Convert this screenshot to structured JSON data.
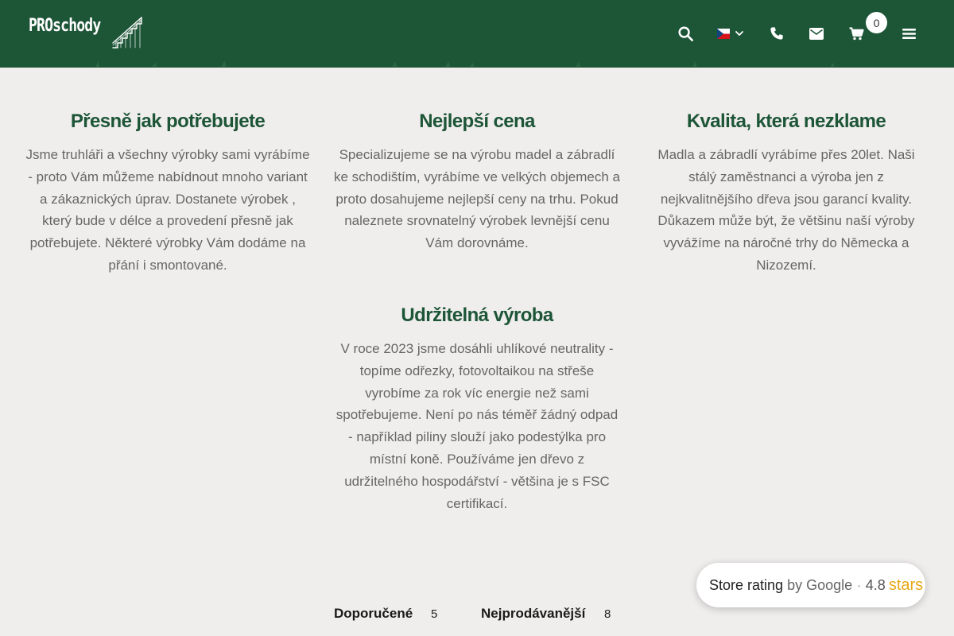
{
  "header": {
    "logo_text": "PROschody",
    "cart_count": "0",
    "icons": [
      "search-icon",
      "czech-flag-icon",
      "chevron-down-icon",
      "phone-icon",
      "envelope-icon",
      "cart-icon",
      "menu-icon"
    ],
    "colors": {
      "header_bg": "#1d5537",
      "heading": "#1d5537",
      "page_bg": "#f0eeed",
      "star": "#e7a817"
    }
  },
  "features": [
    {
      "title": "Přesně jak potřebujete",
      "text": "Jsme truhláři a všechny výrobky sami vyrábíme - proto Vám můžeme nabídnout mnoho variant a zákaznických úprav. Dostanete výrobek , který bude v délce a provedení přesně jak potřebujete. Některé výrobky Vám dodáme na přání i smontované."
    },
    {
      "title": "Nejlepší cena",
      "text": "Specializujeme se na výrobu madel a zábradlí ke schodištím, vyrábíme ve velkých objemech a proto dosahujeme nejlepší ceny na trhu. Pokud naleznete srovnatelný výrobek levnější cenu Vám dorovnáme."
    },
    {
      "title": "Kvalita, která nezklame",
      "text": "Madla a zábradlí vyrábíme přes 20let. Naši stálý zaměstnanci a výroba jen z nejkvalitnějšího dřeva jsou garancí kvality. Důkazem může být, že většinu naší výroby vyvážíme na náročné trhy do Německa a Nizozemí."
    },
    {
      "title": "Udržitelná výroba",
      "text": "V roce 2023 jsme dosáhli uhlíkové neutrality - topíme odřezky, fotovoltaikou na střeše vyrobíme za rok víc energie než sami spotřebujeme. Není po nás téměř žádný odpad - například piliny slouží jako podestýlka pro místní koně. Používáme jen dřevo z udržitelného hospodářství - většina je s FSC certifikací."
    }
  ],
  "rating": {
    "label": "Store rating",
    "provider": "by Google",
    "separator": "·",
    "score": "4.8",
    "stars_text": "stars"
  },
  "tabs": [
    {
      "label": "Doporučené",
      "count": "5"
    },
    {
      "label": "Nejprodávanější",
      "count": "8"
    }
  ]
}
